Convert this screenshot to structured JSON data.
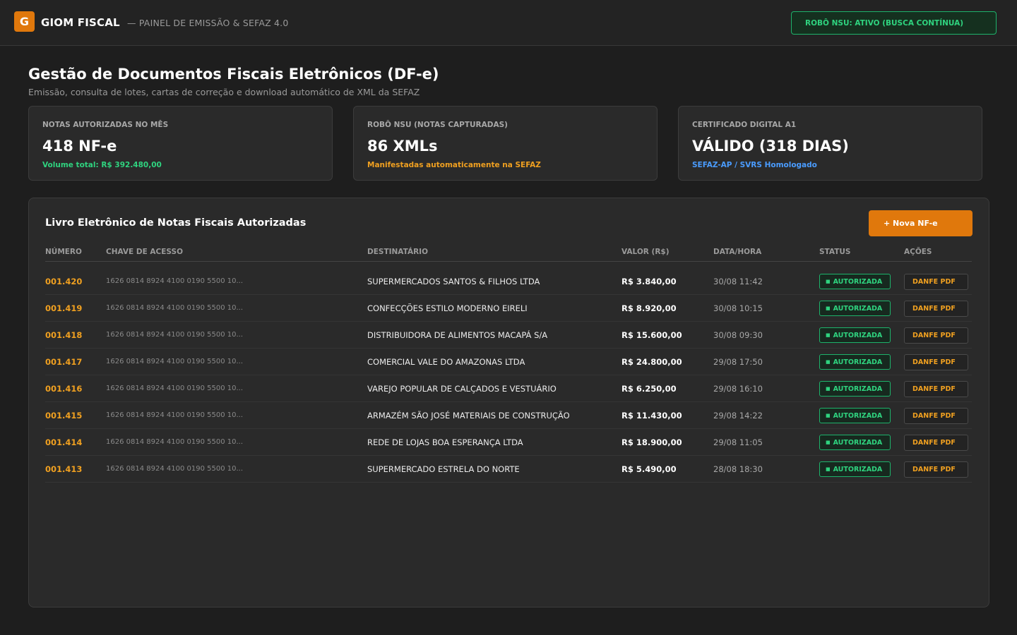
{
  "header": {
    "logo_letter": "G",
    "brand": "GIOM FISCAL",
    "subtitle": "— PAINEL DE EMISSÃO & SEFAZ 4.0",
    "robot_status": "ROBÔ NSU: ATIVO (BUSCA CONTÍNUA)"
  },
  "page": {
    "title": "Gestão de Documentos Fiscais Eletrônicos (DF-e)",
    "subtitle": "Emissão, consulta de lotes, cartas de correção e download automático de XML da SEFAZ"
  },
  "cards": [
    {
      "label": "NOTAS AUTORIZADAS NO MÊS",
      "value": "418 NF-e",
      "note": "Volume total: R$ 392.480,00",
      "note_color": "#2fd37f"
    },
    {
      "label": "ROBÔ NSU (NOTAS CAPTURADAS)",
      "value": "86 XMLs",
      "note": "Manifestadas automaticamente na SEFAZ",
      "note_color": "#f0a020"
    },
    {
      "label": "CERTIFICADO DIGITAL A1",
      "value": "VÁLIDO (318 DIAS)",
      "note": "SEFAZ-AP / SVRS Homologado",
      "note_color": "#4a9cff"
    }
  ],
  "table": {
    "title": "Livro Eletrônico de Notas Fiscais Autorizadas",
    "new_button": "+ Nova NF-e",
    "columns": [
      "NÚMERO",
      "CHAVE DE ACESSO",
      "DESTINATÁRIO",
      "VALOR (R$)",
      "DATA/HORA",
      "STATUS",
      "AÇÕES"
    ],
    "rows": [
      {
        "numero": "001.420",
        "chave": "1626 0814 8924 4100 0190 5500 10...",
        "destinatario": "SUPERMERCADOS SANTOS & FILHOS LTDA",
        "valor": "R$ 3.840,00",
        "data": "30/08 11:42",
        "status": "AUTORIZADA",
        "acao": "DANFE PDF"
      },
      {
        "numero": "001.419",
        "chave": "1626 0814 8924 4100 0190 5500 10...",
        "destinatario": "CONFECÇÕES ESTILO MODERNO EIRELI",
        "valor": "R$ 8.920,00",
        "data": "30/08 10:15",
        "status": "AUTORIZADA",
        "acao": "DANFE PDF"
      },
      {
        "numero": "001.418",
        "chave": "1626 0814 8924 4100 0190 5500 10...",
        "destinatario": "DISTRIBUIDORA DE ALIMENTOS MACAPÁ S/A",
        "valor": "R$ 15.600,00",
        "data": "30/08 09:30",
        "status": "AUTORIZADA",
        "acao": "DANFE PDF"
      },
      {
        "numero": "001.417",
        "chave": "1626 0814 8924 4100 0190 5500 10...",
        "destinatario": "COMERCIAL VALE DO AMAZONAS LTDA",
        "valor": "R$ 24.800,00",
        "data": "29/08 17:50",
        "status": "AUTORIZADA",
        "acao": "DANFE PDF"
      },
      {
        "numero": "001.416",
        "chave": "1626 0814 8924 4100 0190 5500 10...",
        "destinatario": "VAREJO POPULAR DE CALÇADOS E VESTUÁRIO",
        "valor": "R$ 6.250,00",
        "data": "29/08 16:10",
        "status": "AUTORIZADA",
        "acao": "DANFE PDF"
      },
      {
        "numero": "001.415",
        "chave": "1626 0814 8924 4100 0190 5500 10...",
        "destinatario": "ARMAZÉM SÃO JOSÉ MATERIAIS DE CONSTRUÇÃO",
        "valor": "R$ 11.430,00",
        "data": "29/08 14:22",
        "status": "AUTORIZADA",
        "acao": "DANFE PDF"
      },
      {
        "numero": "001.414",
        "chave": "1626 0814 8924 4100 0190 5500 10...",
        "destinatario": "REDE DE LOJAS BOA ESPERANÇA LTDA",
        "valor": "R$ 18.900,00",
        "data": "29/08 11:05",
        "status": "AUTORIZADA",
        "acao": "DANFE PDF"
      },
      {
        "numero": "001.413",
        "chave": "1626 0814 8924 4100 0190 5500 10...",
        "destinatario": "SUPERMERCADO ESTRELA DO NORTE",
        "valor": "R$ 5.490,00",
        "data": "28/08 18:30",
        "status": "AUTORIZADA",
        "acao": "DANFE PDF"
      }
    ]
  },
  "icons": {
    "status_check": "check-icon"
  }
}
